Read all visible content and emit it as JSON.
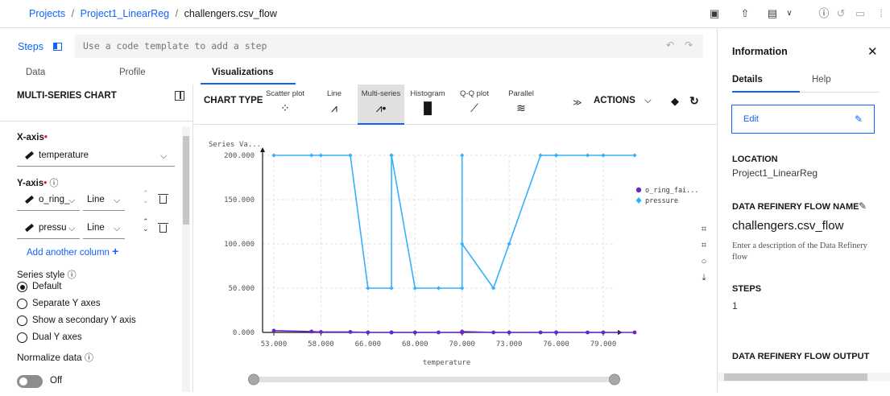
{
  "breadcrumb": {
    "projects": "Projects",
    "project": "Project1_LinearReg",
    "flow": "challengers.csv_flow",
    "separator": "/"
  },
  "steps": {
    "label": "Steps",
    "placeholder": "Use a code template to add a step"
  },
  "tabs": [
    {
      "label": "Data"
    },
    {
      "label": "Profile"
    },
    {
      "label": "Visualizations"
    }
  ],
  "left_panel": {
    "title": "MULTI-SERIES CHART",
    "x_axis_label": "X-axis",
    "x_axis_value": "temperature",
    "y_axis_label": "Y-axis",
    "y_columns": [
      {
        "column": "o_ring_",
        "type": "Line"
      },
      {
        "column": "pressu",
        "type": "Line"
      }
    ],
    "add_column": "Add another column",
    "series_style_label": "Series style",
    "series_style_options": [
      "Default",
      "Separate Y axes",
      "Show a secondary Y axis",
      "Dual Y axes"
    ],
    "normalize_label": "Normalize data",
    "normalize_state": "Off"
  },
  "chart_toolbar": {
    "label": "CHART TYPE",
    "types": [
      {
        "name": "Scatter plot",
        "icon": "scatter-icon"
      },
      {
        "name": "Line",
        "icon": "line-chart-icon"
      },
      {
        "name": "Multi-series",
        "icon": "multi-series-icon"
      },
      {
        "name": "Histogram",
        "icon": "histogram-icon"
      },
      {
        "name": "Q-Q plot",
        "icon": "qq-plot-icon"
      },
      {
        "name": "Parallel",
        "icon": "parallel-icon"
      }
    ],
    "actions_label": "ACTIONS"
  },
  "chart_data": {
    "type": "line",
    "ylabel": "Series Va...",
    "xlabel": "temperature",
    "x_ticks": [
      "53.000",
      "58.000",
      "66.000",
      "68.000",
      "70.000",
      "73.000",
      "76.000",
      "79.000"
    ],
    "y_ticks": [
      "0.000",
      "50.000",
      "100.000",
      "150.000",
      "200.000"
    ],
    "ylim": [
      0,
      200
    ],
    "series": [
      {
        "name": "o_ring_fai...",
        "color": "#6929c4",
        "marker": "circle",
        "values": [
          [
            53,
            2
          ],
          [
            57,
            1
          ],
          [
            58,
            0.5
          ],
          [
            63,
            0.5
          ],
          [
            66,
            0
          ],
          [
            67,
            0
          ],
          [
            67,
            0
          ],
          [
            67,
            0
          ],
          [
            68,
            0
          ],
          [
            69,
            0
          ],
          [
            70,
            0
          ],
          [
            70,
            0
          ],
          [
            70,
            0
          ],
          [
            70,
            1
          ],
          [
            72,
            0
          ],
          [
            73,
            0
          ],
          [
            75,
            0
          ],
          [
            76,
            0
          ],
          [
            76,
            0
          ],
          [
            78,
            0
          ],
          [
            79,
            0
          ],
          [
            81,
            0
          ]
        ]
      },
      {
        "name": "pressure",
        "color": "#33b1ff",
        "marker": "diamond",
        "values": [
          [
            53,
            200
          ],
          [
            57,
            200
          ],
          [
            58,
            200
          ],
          [
            63,
            200
          ],
          [
            66,
            50
          ],
          [
            67,
            50
          ],
          [
            67,
            200
          ],
          [
            67,
            200
          ],
          [
            68,
            50
          ],
          [
            69,
            50
          ],
          [
            70,
            50
          ],
          [
            70,
            50
          ],
          [
            70,
            200
          ],
          [
            70,
            100
          ],
          [
            72,
            50
          ],
          [
            73,
            100
          ],
          [
            75,
            200
          ],
          [
            76,
            200
          ],
          [
            76,
            200
          ],
          [
            78,
            200
          ],
          [
            79,
            200
          ],
          [
            81,
            200
          ]
        ]
      }
    ]
  },
  "info_panel": {
    "title": "Information",
    "tabs": [
      "Details",
      "Help"
    ],
    "edit_label": "Edit",
    "location_heading": "LOCATION",
    "location_value": "Project1_LinearReg",
    "flow_name_heading": "DATA REFINERY FLOW NAME",
    "flow_name_value": "challengers.csv_flow",
    "flow_description": "Enter a description of the Data Refinery flow",
    "steps_heading": "STEPS",
    "steps_value": "1",
    "output_heading": "DATA REFINERY FLOW OUTPUT"
  }
}
